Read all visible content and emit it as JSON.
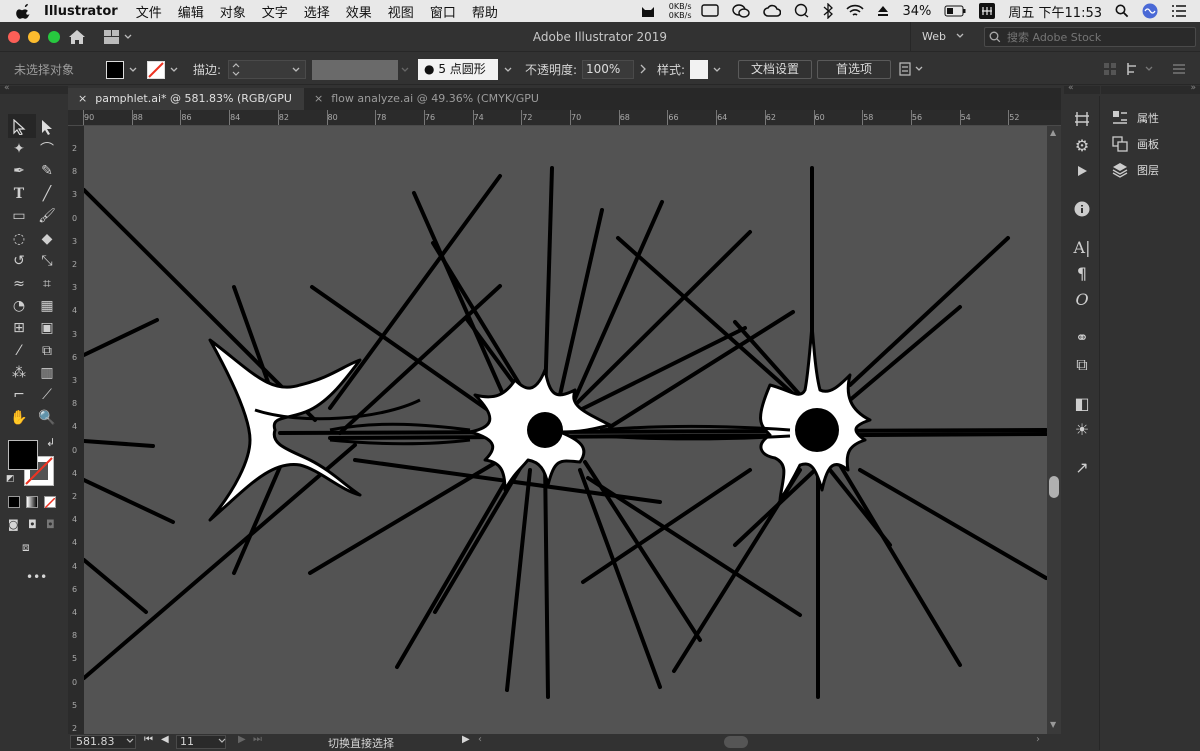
{
  "menubar": {
    "app_name": "Illustrator",
    "menus": [
      "文件",
      "编辑",
      "对象",
      "文字",
      "选择",
      "效果",
      "视图",
      "窗口",
      "帮助"
    ],
    "net_up": "0KB/s",
    "net_down": "0KB/s",
    "battery": "34%",
    "clock": "周五 下午11:53"
  },
  "window": {
    "title": "Adobe Illustrator 2019",
    "workspace": "Web",
    "search_placeholder": "搜索 Adobe Stock"
  },
  "control_bar": {
    "selection_status": "未选择对象",
    "stroke_label": "描边:",
    "brush_label": "5 点圆形",
    "opacity_label": "不透明度:",
    "opacity_value": "100%",
    "style_label": "样式:",
    "doc_settings_button": "文档设置",
    "preferences_button": "首选项"
  },
  "tabs": [
    {
      "label": "pamphlet.ai* @ 581.83% (RGB/GPU 预览)",
      "active": true
    },
    {
      "label": "flow analyze.ai @ 49.36% (CMYK/GPU 预览)",
      "active": false
    }
  ],
  "ruler": {
    "h_ticks": [
      "90",
      "88",
      "86",
      "84",
      "82",
      "80",
      "78",
      "76",
      "74",
      "72",
      "70",
      "68",
      "66",
      "64",
      "62",
      "60",
      "58",
      "56",
      "54",
      "52"
    ],
    "v_ticks": [
      "2",
      "8",
      "3",
      "0",
      "3",
      "2",
      "3",
      "4",
      "3",
      "6",
      "3",
      "8",
      "4",
      "0",
      "4",
      "2",
      "4",
      "4",
      "4",
      "6",
      "4",
      "8",
      "5",
      "0",
      "5",
      "2"
    ]
  },
  "status": {
    "zoom": "581.83",
    "artboard": "11",
    "tool_hint": "切换直接选择"
  },
  "panel": {
    "items": [
      "属性",
      "画板",
      "图层"
    ]
  },
  "colors": {
    "fill": "#000000",
    "canvas": "#535353",
    "ui_bg": "#323232"
  }
}
